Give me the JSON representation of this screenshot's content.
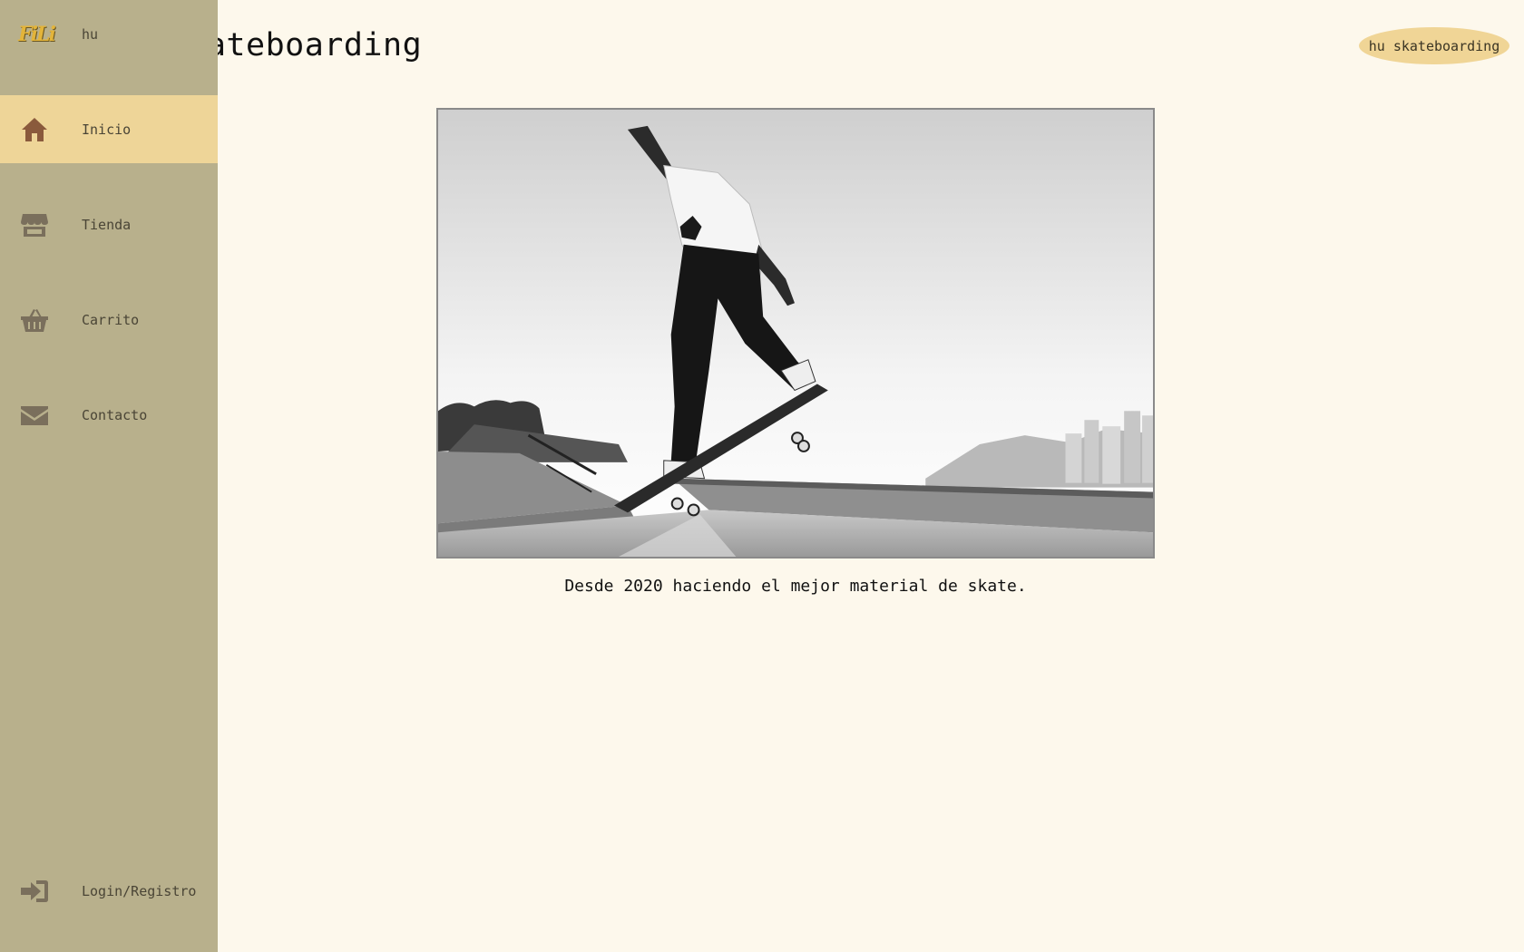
{
  "brand": {
    "logo_text": "FiLi",
    "sidebar_name": "hu",
    "pill_label": "hu skateboarding"
  },
  "page": {
    "heading": "hu skateboarding",
    "caption": "Desde 2020 haciendo el mejor material de skate."
  },
  "sidebar": {
    "items": [
      {
        "label": "Inicio",
        "icon": "home-icon",
        "active": true
      },
      {
        "label": "Tienda",
        "icon": "store-icon",
        "active": false
      },
      {
        "label": "Carrito",
        "icon": "basket-icon",
        "active": false
      },
      {
        "label": "Contacto",
        "icon": "envelope-icon",
        "active": false
      }
    ],
    "footer": {
      "label": "Login/Registro",
      "icon": "sign-in-icon"
    }
  },
  "hero": {
    "alt": "Skateboarder grinding on a ledge in a skatepark, black and white photo"
  },
  "colors": {
    "background": "#fdf8ec",
    "sidebar": "#b8b08c",
    "accent": "#eed598",
    "icon": "#7a6f5c",
    "active_icon": "#8a5a3c"
  }
}
